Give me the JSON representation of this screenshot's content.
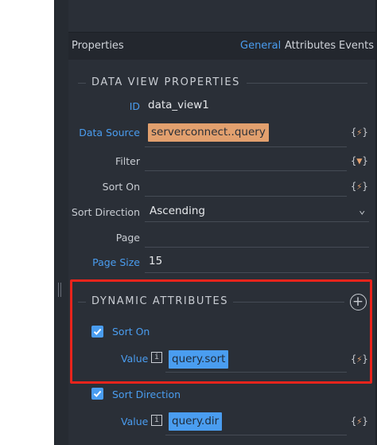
{
  "header": {
    "title": "Properties",
    "tabs": [
      "General",
      "Attributes",
      "Events"
    ],
    "active_tab": "General"
  },
  "data_view": {
    "section_title": "DATA VIEW PROPERTIES",
    "id_label": "ID",
    "id_value": "data_view1",
    "data_source_label": "Data Source",
    "data_source_value": "serverconnect..query",
    "filter_label": "Filter",
    "sort_on_label": "Sort On",
    "sort_direction_label": "Sort Direction",
    "sort_direction_value": "Ascending",
    "page_label": "Page",
    "page_size_label": "Page Size",
    "page_size_value": "15"
  },
  "dynamic": {
    "section_title": "DYNAMIC ATTRIBUTES",
    "add_symbol": "+",
    "items": [
      {
        "name": "Sort On",
        "checked": true,
        "value_label": "Value",
        "value": "query.sort"
      },
      {
        "name": "Sort Direction",
        "checked": true,
        "value_label": "Value",
        "value": "query.dir"
      }
    ]
  },
  "icons": {
    "bolt": "{⚡}",
    "filter": "{▼}",
    "info": "i",
    "chevron": "⌄"
  },
  "colors": {
    "accent": "#4a9df0",
    "chip_orange": "#e2a06e",
    "highlight": "#e8241c",
    "panel": "#2a2f37"
  }
}
